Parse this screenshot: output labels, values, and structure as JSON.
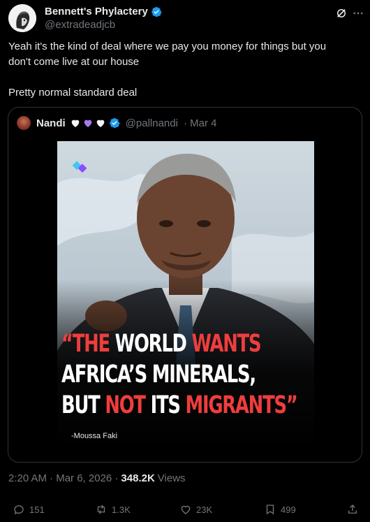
{
  "author": {
    "display_name": "Bennett's Phylactery",
    "handle": "@extradeadjcb"
  },
  "post": {
    "lines": [
      "Yeah it's the kind of deal where we pay you money for things but you",
      "don't come live at our house",
      "Pretty normal standard deal"
    ]
  },
  "quoted_post": {
    "display_name": "Nandi",
    "handle": "@pallnandi",
    "date": "· Mar 4",
    "media_caption": {
      "line1_a": "“THE",
      "line1_b": "WORLD",
      "line1_c": "WANTS",
      "line2": "AFRICA’S MINERALS,",
      "line3_a": "BUT",
      "line3_b": "NOT",
      "line3_c": "ITS",
      "line3_d": "MIGRANTS”",
      "attribution": "-Moussa Faki"
    }
  },
  "meta": {
    "time": "2:20 AM",
    "date": "· Mar 6, 2026 ·",
    "views_count": "348.2K",
    "views_label": "Views"
  },
  "actions": {
    "replies": "151",
    "reposts": "1.3K",
    "likes": "23K",
    "bookmarks": "499"
  },
  "colors": {
    "background": "#000000",
    "text": "#e7e9ea",
    "secondary": "#71767b",
    "verified": "#1d9bf0",
    "caption_red": "#f03d3d",
    "border": "#2f3336"
  },
  "icons": [
    "verified-badge-icon",
    "grok-icon",
    "more-icon",
    "reply-icon",
    "repost-icon",
    "like-icon",
    "bookmark-icon",
    "share-icon",
    "heart-emoji-icon"
  ]
}
